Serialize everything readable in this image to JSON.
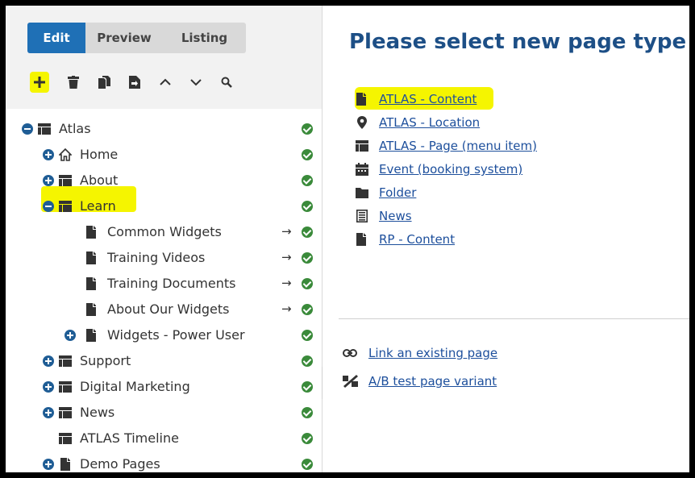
{
  "tabs": [
    {
      "label": "Edit",
      "active": true
    },
    {
      "label": "Preview",
      "active": false
    },
    {
      "label": "Listing",
      "active": false
    }
  ],
  "toolbar": [
    "plus-icon",
    "trash-icon",
    "copy-icon",
    "move-icon",
    "chevron-up-icon",
    "chevron-down-icon",
    "search-icon"
  ],
  "tree": {
    "atlas": "Atlas",
    "home": "Home",
    "about": "About",
    "learn": "Learn",
    "common_widgets": "Common Widgets",
    "training_videos": "Training Videos",
    "training_documents": "Training Documents",
    "about_our_widgets": "About Our Widgets",
    "widgets_power_user": "Widgets - Power User",
    "support": "Support",
    "digital_marketing": "Digital Marketing",
    "news": "News",
    "atlas_timeline": "ATLAS Timeline",
    "demo_pages": "Demo Pages",
    "link_arrow": "→"
  },
  "main": {
    "heading": "Please select new page type",
    "page_types": [
      {
        "label": "ATLAS - Content",
        "icon": "page-icon"
      },
      {
        "label": "ATLAS - Location",
        "icon": "location-pin-icon"
      },
      {
        "label": "ATLAS - Page (menu item)",
        "icon": "menu-page-icon"
      },
      {
        "label": "Event (booking system)",
        "icon": "calendar-icon"
      },
      {
        "label": "Folder",
        "icon": "folder-icon"
      },
      {
        "label": "News",
        "icon": "news-icon"
      },
      {
        "label": "RP - Content",
        "icon": "page-icon"
      }
    ],
    "actions": [
      {
        "label": "Link an existing page",
        "icon": "link-icon"
      },
      {
        "label": "A/B test page variant",
        "icon": "ab-test-icon"
      }
    ]
  },
  "colors": {
    "accent": "#1f70b6",
    "heading": "#1d4f86",
    "link": "#1d4f9c",
    "status_ok": "#3a8a3a",
    "highlight": "#f5f500"
  }
}
